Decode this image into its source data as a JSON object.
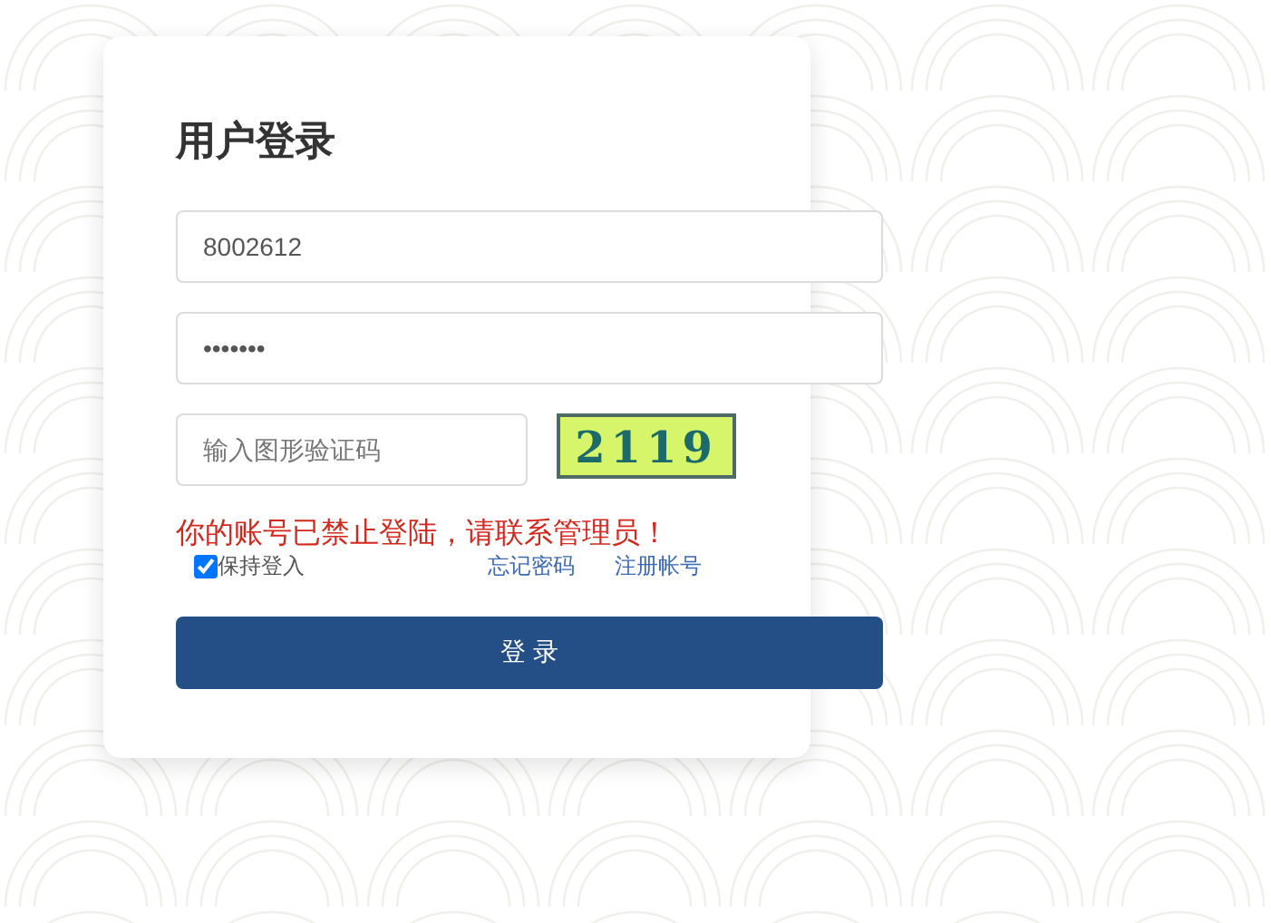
{
  "title": "用户登录",
  "username": {
    "value": "8002612"
  },
  "password": {
    "value": "•••••••"
  },
  "captcha_field": {
    "placeholder": "输入图形验证码"
  },
  "captcha": {
    "text": "2119"
  },
  "error": "你的账号已禁止登陆，请联系管理员！",
  "remember": {
    "label": "保持登入",
    "checked": true
  },
  "links": [
    "忘记密码",
    "注册帐号"
  ],
  "submit": "登 录"
}
